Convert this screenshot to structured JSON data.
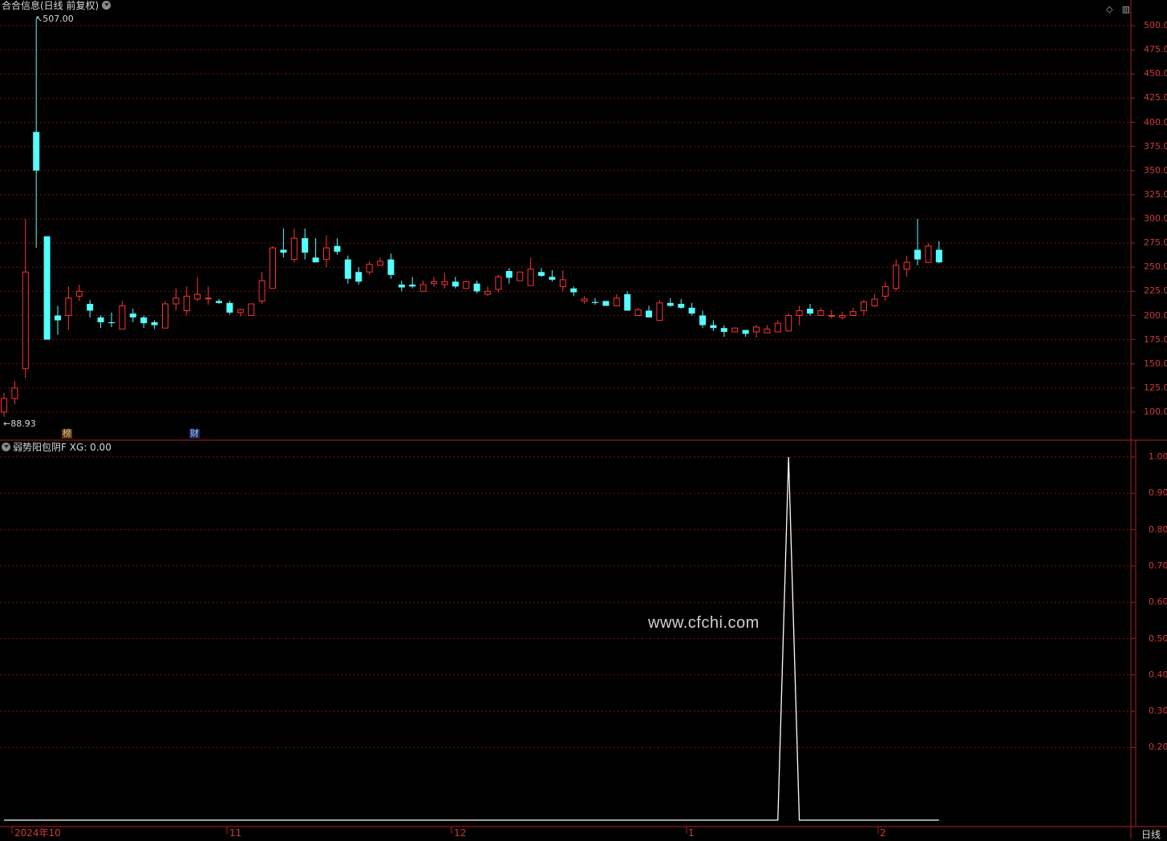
{
  "header": {
    "title": "合合信息(日线 前复权)",
    "tools": [
      "◇",
      "▥"
    ]
  },
  "main_chart": {
    "high_marker": "507.00",
    "low_marker": "88.93",
    "badges": [
      {
        "text": "榜",
        "color": "#e0c080"
      },
      {
        "text": "财",
        "color": "#80b0ff"
      }
    ],
    "y_labels": [
      "500.00",
      "475.00",
      "450.00",
      "425.00",
      "400.00",
      "375.00",
      "350.00",
      "325.00",
      "300.00",
      "275.00",
      "250.00",
      "225.00",
      "200.00",
      "175.00",
      "150.00",
      "125.00",
      "100.00"
    ],
    "colors": {
      "up": "#ff3232",
      "down": "#54ffff",
      "grid": "#7a1414",
      "axis": "#b02020"
    }
  },
  "indicator": {
    "title": "弱势阳包阴F",
    "xg_label": "XG: 0.00",
    "y_labels": [
      "1.00",
      "0.90",
      "0.80",
      "0.70",
      "0.60",
      "0.50",
      "0.40",
      "0.30",
      "0.20"
    ],
    "watermark": "www.cfchi.com"
  },
  "x_axis": {
    "labels": [
      "2024年10",
      "11",
      "12",
      "1",
      "2"
    ],
    "period": "日线"
  },
  "chart_data": {
    "type": "candlestick",
    "ylim": [
      80,
      520
    ],
    "candles": [
      [
        100,
        114,
        95,
        120
      ],
      [
        114,
        125,
        108,
        132
      ],
      [
        145,
        245,
        135,
        300
      ],
      [
        390,
        350,
        270,
        507
      ],
      [
        282,
        175,
        175,
        282
      ],
      [
        200,
        195,
        180,
        210
      ],
      [
        200,
        218,
        185,
        230
      ],
      [
        220,
        225,
        215,
        232
      ],
      [
        212,
        205,
        198,
        216
      ],
      [
        198,
        193,
        187,
        200
      ],
      [
        193,
        192,
        188,
        203
      ],
      [
        186,
        210,
        186,
        215
      ],
      [
        202,
        198,
        193,
        207
      ],
      [
        198,
        192,
        187,
        200
      ],
      [
        193,
        190,
        186,
        195
      ],
      [
        187,
        212,
        187,
        215
      ],
      [
        212,
        218,
        205,
        228
      ],
      [
        205,
        220,
        200,
        230
      ],
      [
        217,
        222,
        215,
        240
      ],
      [
        218,
        218,
        211,
        230
      ],
      [
        215,
        213,
        212,
        217
      ],
      [
        213,
        203,
        201,
        215
      ],
      [
        203,
        206,
        199,
        207
      ],
      [
        200,
        212,
        200,
        212
      ],
      [
        215,
        236,
        212,
        245
      ],
      [
        228,
        270,
        228,
        272
      ],
      [
        268,
        265,
        260,
        290
      ],
      [
        258,
        280,
        255,
        290
      ],
      [
        280,
        265,
        258,
        290
      ],
      [
        260,
        255,
        255,
        280
      ],
      [
        258,
        270,
        250,
        283
      ],
      [
        272,
        266,
        263,
        280
      ],
      [
        258,
        238,
        233,
        262
      ],
      [
        245,
        235,
        232,
        250
      ],
      [
        245,
        253,
        242,
        256
      ],
      [
        252,
        256,
        252,
        260
      ],
      [
        258,
        242,
        238,
        264
      ],
      [
        232,
        229,
        225,
        236
      ],
      [
        232,
        230,
        228,
        240
      ],
      [
        225,
        232,
        225,
        236
      ],
      [
        233,
        235,
        230,
        240
      ],
      [
        232,
        235,
        228,
        244
      ],
      [
        235,
        230,
        228,
        240
      ],
      [
        228,
        235,
        228,
        236
      ],
      [
        233,
        225,
        223,
        236
      ],
      [
        222,
        225,
        220,
        230
      ],
      [
        227,
        240,
        224,
        242
      ],
      [
        246,
        239,
        233,
        249
      ],
      [
        236,
        245,
        236,
        245
      ],
      [
        231,
        248,
        231,
        260
      ],
      [
        245,
        241,
        240,
        249
      ],
      [
        240,
        237,
        235,
        247
      ],
      [
        230,
        237,
        225,
        247
      ],
      [
        228,
        224,
        220,
        230
      ],
      [
        215,
        217,
        212,
        220
      ],
      [
        214,
        213,
        211,
        218
      ],
      [
        215,
        210,
        210,
        215
      ],
      [
        210,
        218,
        210,
        222
      ],
      [
        222,
        205,
        205,
        225
      ],
      [
        200,
        206,
        200,
        208
      ],
      [
        205,
        198,
        198,
        210
      ],
      [
        195,
        213,
        195,
        216
      ],
      [
        213,
        210,
        209,
        218
      ],
      [
        212,
        208,
        207,
        217
      ],
      [
        208,
        202,
        200,
        213
      ],
      [
        200,
        190,
        187,
        205
      ],
      [
        190,
        187,
        184,
        195
      ],
      [
        187,
        183,
        178,
        190
      ],
      [
        183,
        187,
        183,
        185
      ],
      [
        185,
        181,
        178,
        185
      ],
      [
        183,
        188,
        177,
        190
      ],
      [
        182,
        186,
        182,
        190
      ],
      [
        183,
        192,
        183,
        195
      ],
      [
        184,
        200,
        184,
        202
      ],
      [
        200,
        205,
        190,
        210
      ],
      [
        207,
        202,
        200,
        212
      ],
      [
        200,
        205,
        200,
        208
      ],
      [
        200,
        200,
        197,
        206
      ],
      [
        198,
        200,
        196,
        204
      ],
      [
        200,
        204,
        200,
        208
      ],
      [
        205,
        214,
        200,
        216
      ],
      [
        210,
        217,
        209,
        222
      ],
      [
        220,
        230,
        215,
        235
      ],
      [
        228,
        252,
        225,
        258
      ],
      [
        248,
        255,
        240,
        262
      ],
      [
        268,
        258,
        252,
        300
      ],
      [
        255,
        272,
        255,
        275
      ],
      [
        268,
        255,
        254,
        277
      ]
    ],
    "indicator_series": {
      "name": "XG",
      "values": [
        0,
        0,
        0,
        0,
        0,
        0,
        0,
        0,
        0,
        0,
        0,
        0,
        0,
        0,
        0,
        0,
        0,
        0,
        0,
        0,
        0,
        0,
        0,
        0,
        0,
        0,
        0,
        0,
        0,
        0,
        0,
        0,
        0,
        0,
        0,
        0,
        0,
        0,
        0,
        0,
        0,
        0,
        0,
        0,
        0,
        0,
        0,
        0,
        0,
        0,
        0,
        0,
        0,
        0,
        0,
        0,
        0,
        0,
        0,
        0,
        0,
        0,
        0,
        0,
        0,
        0,
        0,
        0,
        0,
        0,
        0,
        0,
        0,
        1,
        0,
        0,
        0,
        0,
        0,
        0,
        0,
        0,
        0,
        0,
        0,
        0,
        0,
        0
      ],
      "ylim": [
        0,
        1.0
      ]
    }
  }
}
